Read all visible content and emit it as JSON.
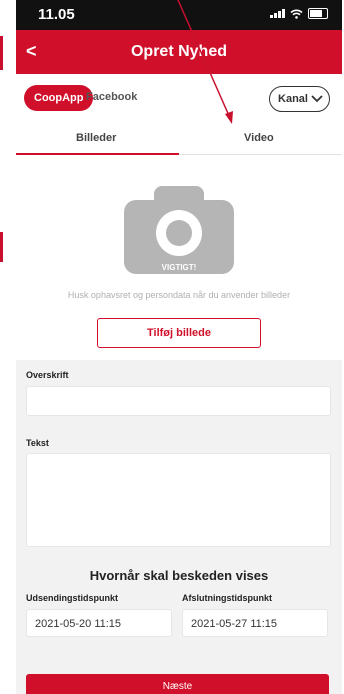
{
  "status_bar": {
    "time": "11.05"
  },
  "header": {
    "title": "Opret Nyhed",
    "back_glyph": "<"
  },
  "channels": {
    "active": "CoopApp",
    "other": "Facebook",
    "dropdown_label": "Kanal"
  },
  "tabs": [
    {
      "label": "Billeder",
      "selected": true
    },
    {
      "label": "Video",
      "selected": false
    }
  ],
  "camera": {
    "icon": "camera-icon",
    "label": "VIGTIGT!"
  },
  "hint_text": "Husk ophavsret og persondata når du anvender billeder",
  "add_image_button": "Tilføj billede",
  "form": {
    "headline_label": "Overskrift",
    "text_label": "Tekst",
    "schedule_title": "Hvornår skal beskeden vises",
    "start_label": "Udsendingstidspunkt",
    "start_value": "2021-05-20 11:15",
    "end_label": "Afslutningstidspunkt",
    "end_value": "2021-05-27 11:15"
  },
  "next_button": "Næste",
  "colors": {
    "brand_red": "#d0102a",
    "status_bar": "#111111",
    "form_bg": "#f2f2f2"
  }
}
